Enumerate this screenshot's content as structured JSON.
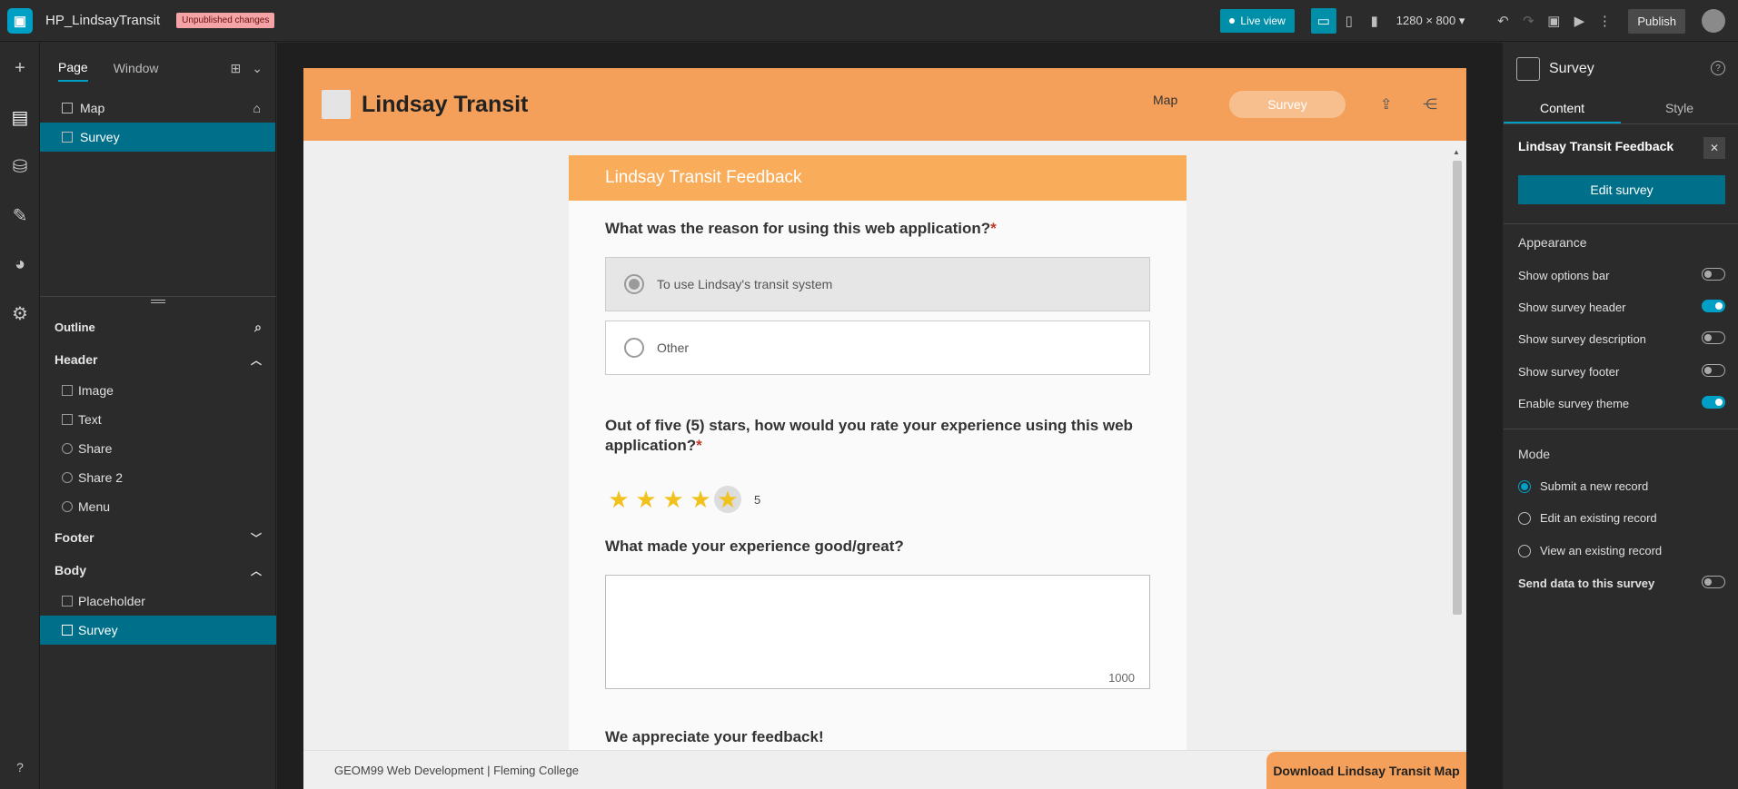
{
  "topbar": {
    "app_title": "HP_LindsayTransit",
    "badge": "Unpublished changes",
    "live_view": "Live view",
    "resolution": "1280 × 800",
    "publish": "Publish"
  },
  "page_panel": {
    "tabs": [
      "Page",
      "Window"
    ],
    "pages": [
      {
        "label": "Map"
      },
      {
        "label": "Survey",
        "selected": true
      }
    ]
  },
  "outline": {
    "title": "Outline",
    "header": {
      "label": "Header",
      "items": [
        "Image",
        "Text",
        "Share",
        "Share 2",
        "Menu"
      ]
    },
    "footer": {
      "label": "Footer"
    },
    "body": {
      "label": "Body",
      "items": [
        "Placeholder",
        "Survey"
      ]
    }
  },
  "app": {
    "header_title": "Lindsay Transit",
    "nav": [
      "Map",
      "Survey"
    ],
    "footer_text": "GEOM99 Web Development | Fleming College",
    "footer_button": "Download Lindsay Transit Map"
  },
  "survey": {
    "title": "Lindsay Transit Feedback",
    "q1": "What was the reason for using this web application?",
    "q1_options": [
      "To use Lindsay's transit system",
      "Other"
    ],
    "q2": "Out of five (5) stars, how would you rate your experience using this web application?",
    "rating": 5,
    "rating_max": 5,
    "rating_label": "5",
    "q3": "What made your experience good/great?",
    "char_limit": "1000",
    "closing": "We appreciate your feedback!",
    "required_mark": "*"
  },
  "right_panel": {
    "title": "Survey",
    "tabs": [
      "Content",
      "Style"
    ],
    "survey_name": "Lindsay Transit Feedback",
    "edit_button": "Edit survey",
    "appearance_label": "Appearance",
    "toggles": [
      {
        "label": "Show options bar",
        "on": false
      },
      {
        "label": "Show survey header",
        "on": true
      },
      {
        "label": "Show survey description",
        "on": false
      },
      {
        "label": "Show survey footer",
        "on": false
      },
      {
        "label": "Enable survey theme",
        "on": true
      }
    ],
    "mode_label": "Mode",
    "modes": [
      {
        "label": "Submit a new record",
        "selected": true
      },
      {
        "label": "Edit an existing record",
        "selected": false
      },
      {
        "label": "View an existing record",
        "selected": false
      }
    ],
    "send_data_label": "Send data to this survey",
    "send_data_on": false
  }
}
